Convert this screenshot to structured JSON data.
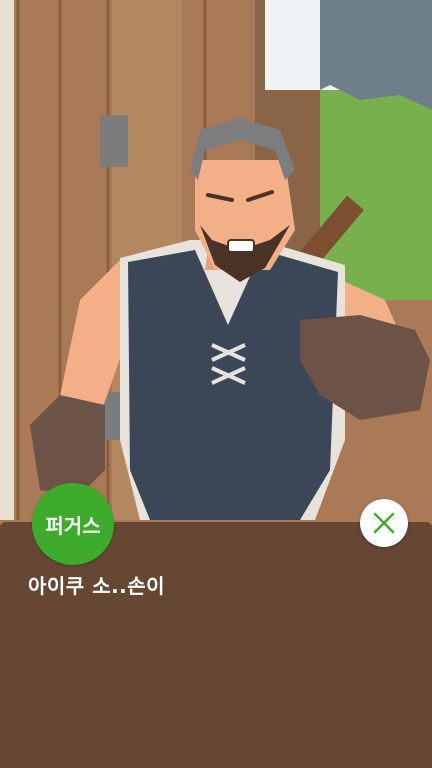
{
  "dialog": {
    "speaker_name": "퍼거스",
    "line": "아이쿠 소..손이"
  },
  "icons": {
    "close": "close-icon"
  },
  "colors": {
    "speaker_badge": "#3eab2c",
    "close_x": "#3eab2c",
    "panel": "#5c4030"
  }
}
